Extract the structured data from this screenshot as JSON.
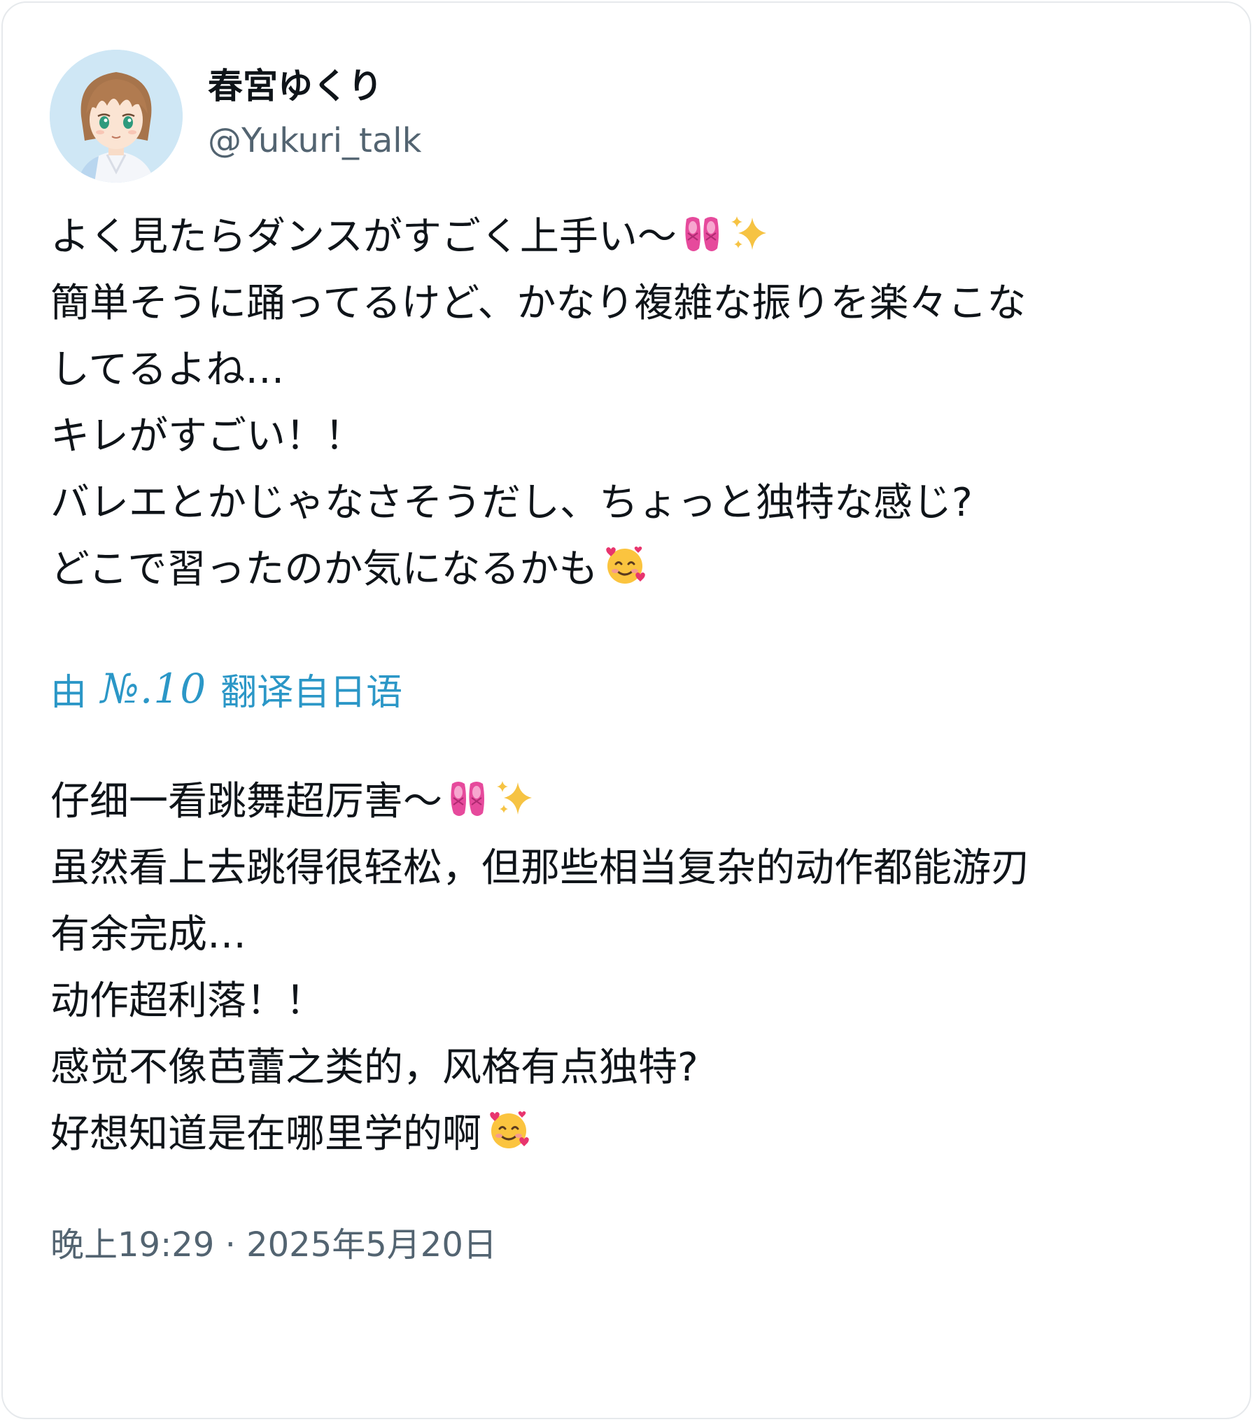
{
  "author": {
    "display_name": "春宮ゆくり",
    "handle": "@Yukuri_talk",
    "avatar_icon": "anime-avatar-icon"
  },
  "tweet": {
    "lines": [
      {
        "text": "よく見たらダンスがすごく上手い〜",
        "emojis": [
          "ballet-shoes-icon",
          "sparkles-icon"
        ]
      },
      {
        "text": "簡単そうに踊ってるけど、かなり複雑な振りを楽々こな",
        "emojis": []
      },
      {
        "text": "してるよね…",
        "emojis": []
      },
      {
        "text": "キレがすごい！！",
        "emojis": []
      },
      {
        "text": "バレエとかじゃなさそうだし、ちょっと独特な感じ?",
        "emojis": []
      },
      {
        "text": "どこで習ったのか気になるかも",
        "emojis": [
          "smiling-face-with-hearts-icon"
        ]
      }
    ]
  },
  "translation": {
    "prefix": "由",
    "brand": "№.10",
    "suffix": "翻译自日语",
    "lines": [
      {
        "text": "仔细一看跳舞超厉害～",
        "emojis": [
          "ballet-shoes-icon",
          "sparkles-icon"
        ]
      },
      {
        "text": "虽然看上去跳得很轻松，但那些相当复杂的动作都能游刃",
        "emojis": []
      },
      {
        "text": "有余完成…",
        "emojis": []
      },
      {
        "text": "动作超利落！！",
        "emojis": []
      },
      {
        "text": "感觉不像芭蕾之类的，风格有点独特?",
        "emojis": []
      },
      {
        "text": "好想知道是在哪里学的啊",
        "emojis": [
          "smiling-face-with-hearts-icon"
        ]
      }
    ]
  },
  "timestamp": "晚上19:29 · 2025年5月20日",
  "colors": {
    "link": "#2b97c7",
    "secondary_text": "#536471",
    "primary_text": "#0f1419",
    "border": "#e6e9ec"
  }
}
